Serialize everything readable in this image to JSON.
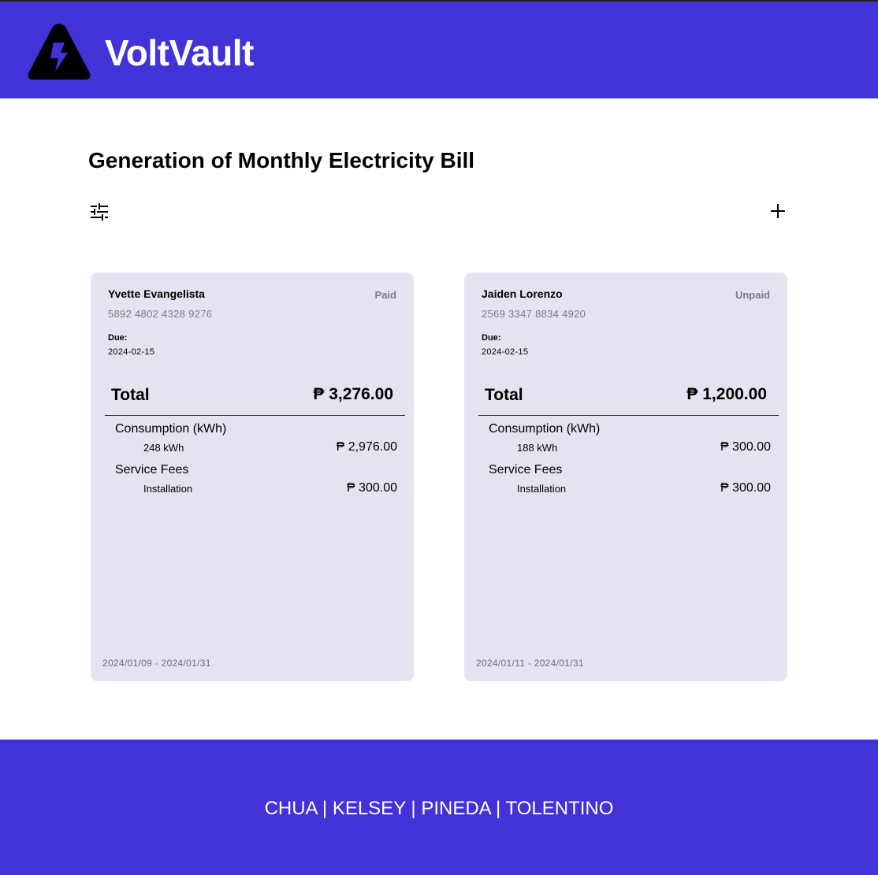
{
  "header": {
    "brand": "VoltVault",
    "logo_icon": "lightning-warning-icon"
  },
  "page": {
    "title": "Generation of Monthly Electricity Bill",
    "filter_icon": "sliders-icon",
    "add_icon": "plus-icon"
  },
  "bills": [
    {
      "name": "Yvette Evangelista",
      "status": "Paid",
      "account": "5892 4802 4328 9276",
      "due_label": "Due:",
      "due_date": "2024-02-15",
      "total_label": "Total",
      "total": "₱ 3,276.00",
      "consumption_label": "Consumption (kWh)",
      "consumption_kwh": "248 kWh",
      "consumption_amount": "₱ 2,976.00",
      "service_label": "Service Fees",
      "service_item": "Installation",
      "service_amount": "₱ 300.00",
      "period": "2024/01/09 - 2024/01/31"
    },
    {
      "name": "Jaiden Lorenzo",
      "status": "Unpaid",
      "account": "2569 3347 8834 4920",
      "due_label": "Due:",
      "due_date": "2024-02-15",
      "total_label": "Total",
      "total": "₱ 1,200.00",
      "consumption_label": "Consumption (kWh)",
      "consumption_kwh": "188 kWh",
      "consumption_amount": "₱ 300.00",
      "service_label": "Service Fees",
      "service_item": "Installation",
      "service_amount": "₱ 300.00",
      "period": "2024/01/11 - 2024/01/31"
    }
  ],
  "footer": {
    "credits": "CHUA | KELSEY | PINEDA | TOLENTINO"
  },
  "colors": {
    "brand": "#4133d8",
    "card": "#e4e4f0"
  }
}
